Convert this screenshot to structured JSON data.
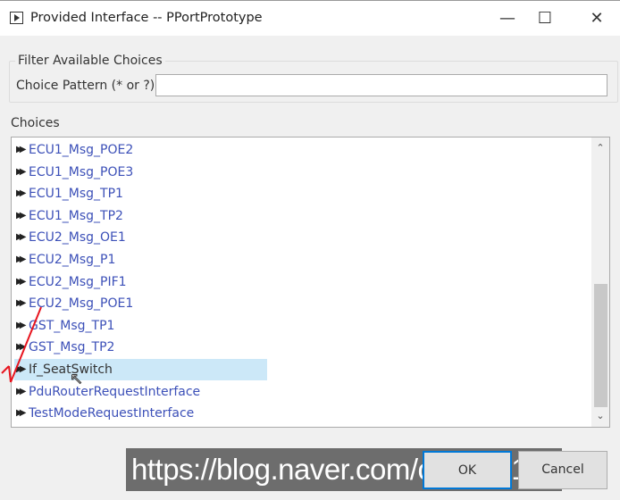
{
  "window": {
    "title": "Provided Interface -- PPortPrototype",
    "minimize": "—",
    "maximize": "☐",
    "close": "✕"
  },
  "filter": {
    "group_label": "Filter Available Choices",
    "pattern_label": "Choice Pattern (* or ?)",
    "pattern_value": ""
  },
  "choices": {
    "label": "Choices",
    "items": [
      "ECU1_Msg_POE2",
      "ECU1_Msg_POE3",
      "ECU1_Msg_TP1",
      "ECU1_Msg_TP2",
      "ECU2_Msg_OE1",
      "ECU2_Msg_P1",
      "ECU2_Msg_PIF1",
      "ECU2_Msg_POE1",
      "GST_Msg_TP1",
      "GST_Msg_TP2",
      "If_SeatSwitch",
      "PduRouterRequestInterface",
      "TestModeRequestInterface"
    ],
    "selected": "If_SeatSwitch",
    "scroll_position": 1.0
  },
  "buttons": {
    "ok": "OK",
    "cancel": "Cancel"
  },
  "watermark": "https://blog.naver.com/cjsksk3113"
}
